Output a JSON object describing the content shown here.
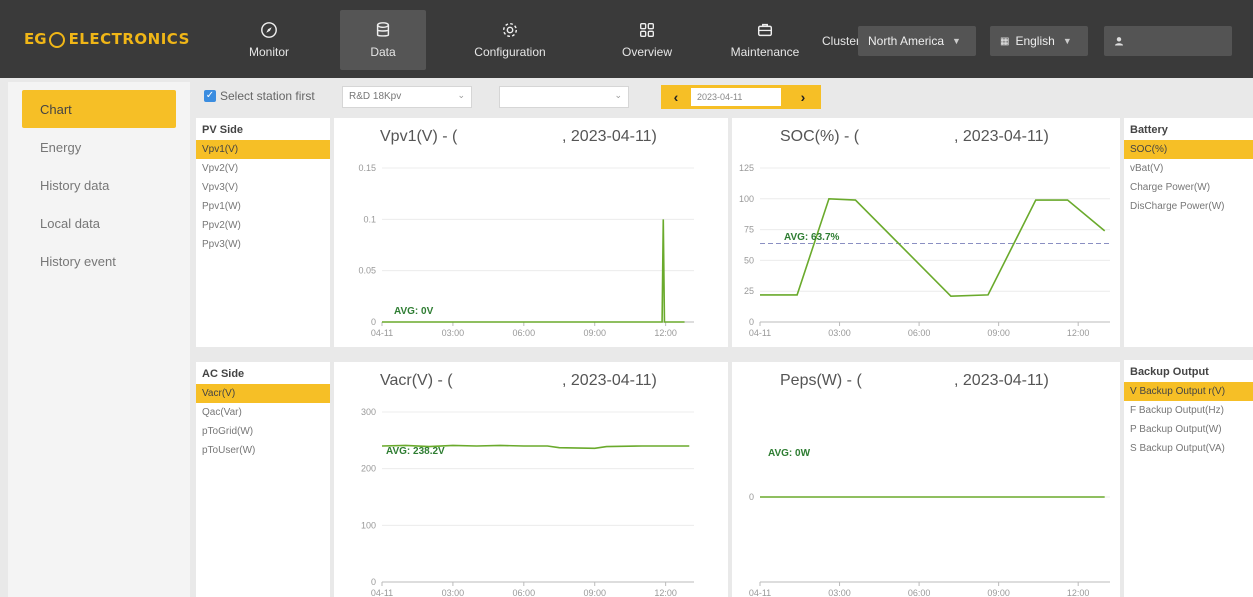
{
  "brand": {
    "logo_text": "EGUELECTRONICS"
  },
  "nav": [
    {
      "label": "Monitor",
      "icon": "compass-icon",
      "active": false
    },
    {
      "label": "Data",
      "icon": "database-icon",
      "active": true
    },
    {
      "label": "Configuration",
      "icon": "gear-icon",
      "active": false
    },
    {
      "label": "Overview",
      "icon": "grid-icon",
      "active": false
    },
    {
      "label": "Maintenance",
      "icon": "briefcase-icon",
      "active": false
    }
  ],
  "header": {
    "cluster_label": "Cluster:",
    "cluster_value": "North America",
    "language": "English",
    "user": ""
  },
  "sidebar": {
    "items": [
      {
        "label": "Chart",
        "active": true
      },
      {
        "label": "Energy"
      },
      {
        "label": "History data"
      },
      {
        "label": "Local data"
      },
      {
        "label": "History event"
      }
    ]
  },
  "toolbar": {
    "checkbox_label": "Select station first",
    "station": "R&D 18Kpv",
    "device": "",
    "date": "2023-04-11"
  },
  "pv_side": {
    "title": "PV Side",
    "items": [
      "Vpv1(V)",
      "Vpv2(V)",
      "Vpv3(V)",
      "Ppv1(W)",
      "Ppv2(W)",
      "Ppv3(W)"
    ]
  },
  "ac_side": {
    "title": "AC Side",
    "items": [
      "Vacr(V)",
      "Qac(Var)",
      "pToGrid(W)",
      "pToUser(W)"
    ]
  },
  "battery": {
    "title": "Battery",
    "items": [
      "SOC(%)",
      "vBat(V)",
      "Charge Power(W)",
      "DisCharge Power(W)"
    ]
  },
  "backup": {
    "title": "Backup Output",
    "items": [
      "V Backup Output r(V)",
      "F Backup Output(Hz)",
      "P Backup Output(W)",
      "S Backup Output(VA)"
    ]
  },
  "colors": {
    "accent": "#f6bf26",
    "line": "#6aaa2c",
    "topbar": "#3a3a3a"
  },
  "chart_data": [
    {
      "type": "line",
      "title": "Vpv1(V) - (",
      "date": ", 2023-04-11)",
      "x": [
        "04-11",
        "03:00",
        "06:00",
        "09:00",
        "12:00"
      ],
      "ylim": [
        0,
        0.15
      ],
      "yticks": [
        "0",
        "0.05",
        "0.1",
        "0.15"
      ],
      "avg_label": "AVG: 0V",
      "series": [
        {
          "points": [
            [
              0,
              0
            ],
            [
              11.85,
              0
            ],
            [
              11.9,
              0.1
            ],
            [
              11.95,
              0
            ],
            [
              12.8,
              0
            ]
          ]
        }
      ]
    },
    {
      "type": "line",
      "title": "SOC(%) - (",
      "date": ", 2023-04-11)",
      "x": [
        "04-11",
        "03:00",
        "06:00",
        "09:00",
        "12:00"
      ],
      "ylim": [
        0,
        125
      ],
      "yticks": [
        "0",
        "25",
        "50",
        "75",
        "100",
        "125"
      ],
      "avg_label": "AVG: 63.7%",
      "avg": 63.7,
      "series": [
        {
          "points": [
            [
              0,
              22
            ],
            [
              1.4,
              22
            ],
            [
              2.6,
              100
            ],
            [
              3.6,
              99
            ],
            [
              7.2,
              21
            ],
            [
              8.6,
              22
            ],
            [
              10.4,
              99
            ],
            [
              11.6,
              99
            ],
            [
              13.0,
              74
            ]
          ]
        }
      ]
    },
    {
      "type": "line",
      "title": "Vacr(V) - (",
      "date": ", 2023-04-11)",
      "x": [
        "04-11",
        "03:00",
        "06:00",
        "09:00",
        "12:00"
      ],
      "ylim": [
        0,
        300
      ],
      "yticks": [
        "0",
        "100",
        "200",
        "300"
      ],
      "avg_label": "AVG: 238.2V",
      "series": [
        {
          "points": [
            [
              0,
              240
            ],
            [
              1,
              241
            ],
            [
              2,
              239
            ],
            [
              3,
              241
            ],
            [
              4,
              240
            ],
            [
              5,
              241
            ],
            [
              6,
              240
            ],
            [
              7,
              240
            ],
            [
              7.5,
              237
            ],
            [
              9,
              236
            ],
            [
              9.5,
              239
            ],
            [
              11,
              240
            ],
            [
              13,
              240
            ]
          ]
        }
      ]
    },
    {
      "type": "line",
      "title": "Peps(W) - (",
      "date": ", 2023-04-11)",
      "x": [
        "04-11",
        "03:00",
        "06:00",
        "09:00",
        "12:00"
      ],
      "ylim": [
        -1,
        1
      ],
      "yticks": [
        "0"
      ],
      "avg_label": "AVG: 0W",
      "series": [
        {
          "points": [
            [
              0,
              0
            ],
            [
              13,
              0
            ]
          ]
        }
      ]
    }
  ]
}
